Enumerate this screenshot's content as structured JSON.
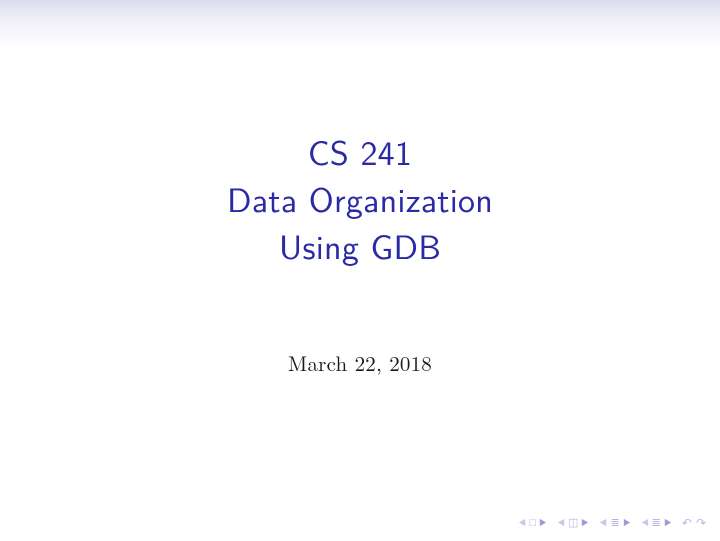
{
  "title": {
    "line1": "CS 241",
    "line2": "Data Organization",
    "line3": "Using GDB"
  },
  "date": "March 22, 2018",
  "nav": {
    "frame_icon": "□",
    "doc_icon": "◫",
    "sec_icon": "≣",
    "subsec_icon": "≣",
    "back": "↶",
    "forward": "↷"
  }
}
